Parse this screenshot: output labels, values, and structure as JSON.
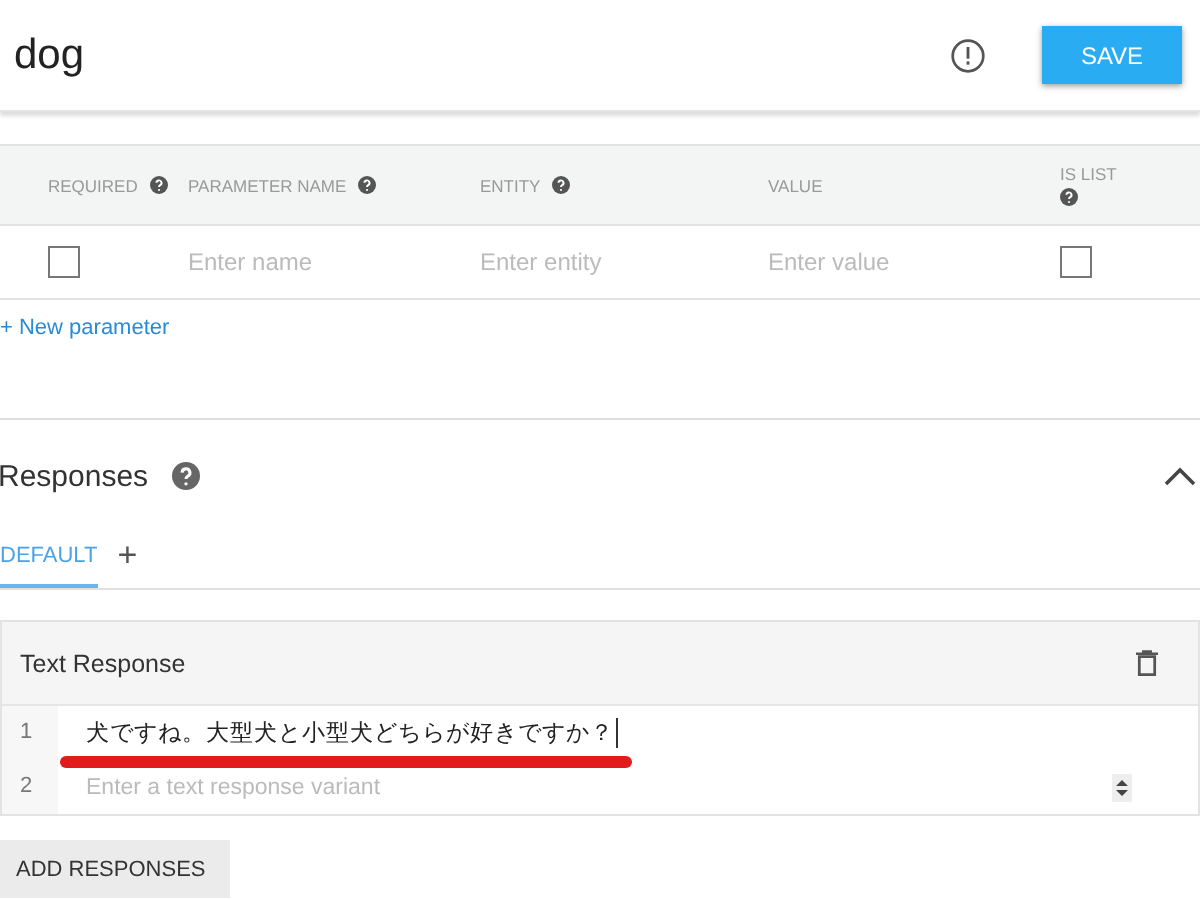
{
  "header": {
    "title": "dog",
    "save_label": "SAVE"
  },
  "parameters": {
    "columns": [
      {
        "label": "REQUIRED",
        "help": true
      },
      {
        "label": "PARAMETER NAME",
        "help": true
      },
      {
        "label": "ENTITY",
        "help": true
      },
      {
        "label": "VALUE",
        "help": false
      },
      {
        "label": "IS LIST",
        "help": true
      }
    ],
    "row": {
      "required": false,
      "name_placeholder": "Enter name",
      "entity_placeholder": "Enter entity",
      "value_placeholder": "Enter value",
      "is_list": false
    },
    "add_link": "+ New parameter"
  },
  "responses": {
    "title": "Responses",
    "expanded": true,
    "tabs": [
      {
        "label": "DEFAULT",
        "selected": true,
        "kind": "text"
      },
      {
        "label": "+",
        "selected": false,
        "kind": "add"
      }
    ],
    "card_title": "Text Response",
    "lines": [
      {
        "number": "1",
        "value": "犬ですね。大型犬と小型犬どちらが好きですか？",
        "underlined": true
      },
      {
        "number": "2",
        "placeholder": "Enter a text response variant",
        "underlined": false
      }
    ],
    "add_button": "ADD RESPONSES"
  }
}
